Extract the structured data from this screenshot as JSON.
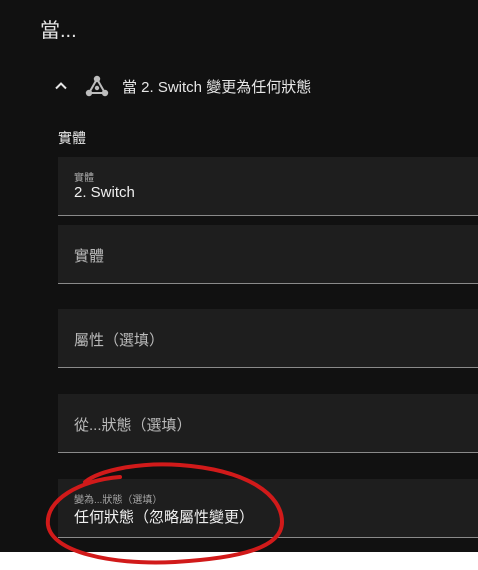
{
  "section": {
    "title": "當..."
  },
  "trigger": {
    "title": "當 2. Switch 變更為任何狀態"
  },
  "entity_group": {
    "label": "實體"
  },
  "fields": {
    "entity": {
      "label": "實體",
      "value": "2. Switch"
    },
    "entity_empty": {
      "placeholder": "實體"
    },
    "attribute": {
      "placeholder": "屬性（選填）"
    },
    "from_state": {
      "placeholder": "從...狀態（選填）"
    },
    "to_state": {
      "label": "變為...狀態（選填）",
      "value": "任何狀態（忽略屬性變更）"
    }
  },
  "annotation": {
    "color": "#d11a1a"
  },
  "icons": {
    "chevron": "chevron-up-icon",
    "trigger": "state-trigger-icon"
  }
}
